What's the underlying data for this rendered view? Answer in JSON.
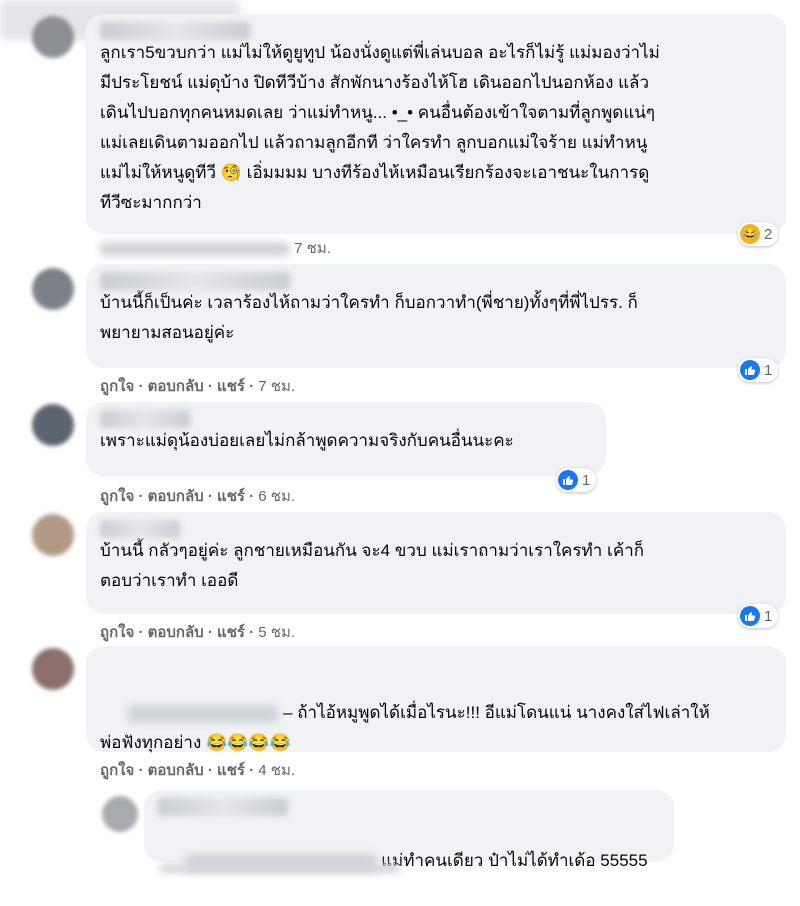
{
  "comments": [
    {
      "text": "ลูกเรา5ขวบกว่า แม่ไม่ให้ดูยูทูป น้องนั่งดูแต่พี่เล่นบอล อะไรก็ไม่รู้ แม่มองว่าไม่\nมีประโยชน์ แม่ดุบ้าง ปิดทีวีบ้าง สักพักนางร้องไห้โฮ เดินออกไปนอกห้อง แล้ว\nเดินไปบอกทุกคนหมดเลย ว่าแม่ทำหนู... •_• คนอื่นต้องเข้าใจตามที่ลูกพูดแน่ๆ\nแม่เลยเดินตามออกไป แล้วถามลูกอีกที ว่าใครทำ ลูกบอกแม่ใจร้าย แม่ทำหนู\nแม่ไม่ให้หนูดูทีวี 🧐 เอิ่มมมม บางทีร้องไห้เหมือนเรียกร้องจะเอาชนะในการดู\nทีวีซะมากกว่า",
      "time": "7 ชม.",
      "reaction_count": "2"
    },
    {
      "text": "บ้านนี้ก็เป็นค่ะ เวลาร้องไห้ถามว่าใครทำ ก็บอกวาทำ(พี่ชาย)ทั้งๆที่พี่ไปรร. ก็\nพยายามสอนอยู่ค่ะ",
      "like": "ถูกใจ",
      "reply": "ตอบกลับ",
      "share": "แชร์",
      "time": "7 ชม.",
      "reaction_count": "1"
    },
    {
      "text": "เพราะแม่ดุน้องบ่อยเลยไม่กล้าพูดความจริงกับคนอื่นนะคะ",
      "like": "ถูกใจ",
      "reply": "ตอบกลับ",
      "share": "แชร์",
      "time": "6 ชม.",
      "reaction_count": "1"
    },
    {
      "text": "บ้านนี้ กลัวๆอยู่ค่ะ ลูกชายเหมือนกัน จะ4 ขวบ แม่เราถามว่าเราใครทำ เค้าก็\nตอบว่าเราทำ เออดี",
      "like": "ถูกใจ",
      "reply": "ตอบกลับ",
      "share": "แชร์",
      "time": "5 ชม.",
      "reaction_count": "1"
    },
    {
      "text": " – ถ้าไอ้หมูพูดได้เมื่อไรนะ!!! อีแม่โดนแน่ นางคงใส่ไฟเล่าให้\nพ่อฟังทุกอย่าง 😂😂😂😂",
      "like": "ถูกใจ",
      "reply": "ตอบกลับ",
      "share": "แชร์",
      "time": "4 ชม."
    },
    {
      "text": "แม่ทำคนเดียว ป๋าไม่ได้ทำเด้อ 55555"
    }
  ],
  "colors": {
    "like_blue": "#1877f2",
    "bubble": "#f0f2f5",
    "muted": "#65676b"
  }
}
